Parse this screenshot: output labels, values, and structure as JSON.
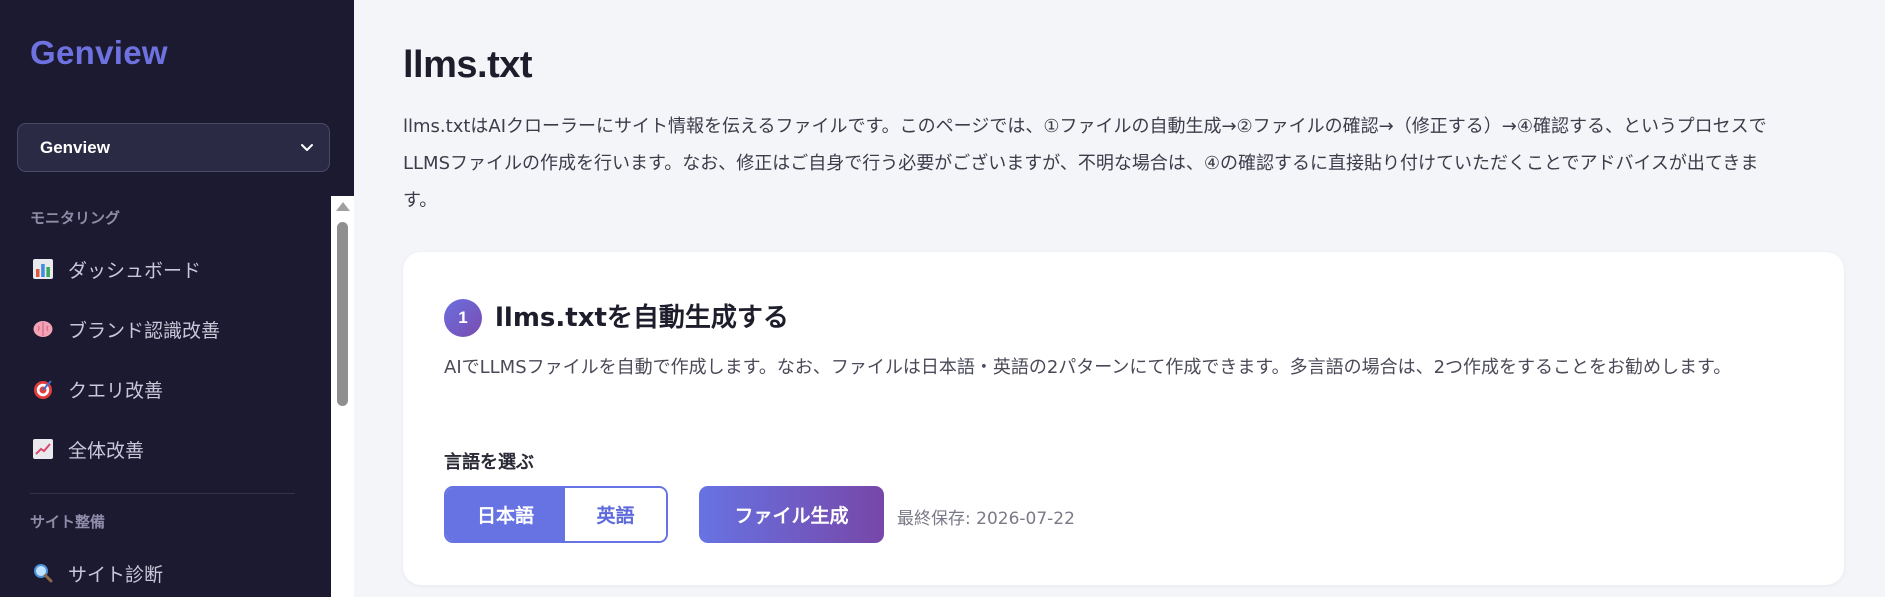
{
  "sidebar": {
    "logo": "Genview",
    "site_select": {
      "value": "Genview"
    },
    "sections": [
      {
        "title": "モニタリング",
        "items": [
          {
            "label": "ダッシュボード",
            "icon": "bar-chart-icon"
          },
          {
            "label": "ブランド認識改善",
            "icon": "brain-icon"
          },
          {
            "label": "クエリ改善",
            "icon": "target-icon"
          },
          {
            "label": "全体改善",
            "icon": "trend-chart-icon"
          }
        ]
      },
      {
        "title": "サイト整備",
        "items": [
          {
            "label": "サイト診断",
            "icon": "magnifier-icon"
          }
        ]
      }
    ]
  },
  "main": {
    "title": "llms.txt",
    "intro": "llms.txtはAIクローラーにサイト情報を伝えるファイルです。このページでは、①ファイルの自動生成→②ファイルの確認→（修正する）→④確認する、というプロセスでLLMSファイルの作成を行います。なお、修正はご自身で行う必要がございますが、不明な場合は、④の確認するに直接貼り付けていただくことでアドバイスが出てきます。",
    "step1": {
      "number": "1",
      "title": "llms.txtを自動生成する",
      "description": "AIでLLMSファイルを自動で作成します。なお、ファイルは日本語・英語の2パターンにて作成できます。多言語の場合は、2つ作成をすることをお勧めします。",
      "language_label": "言語を選ぶ",
      "languages": [
        {
          "label": "日本語",
          "selected": true
        },
        {
          "label": "英語",
          "selected": false
        }
      ],
      "generate_button": "ファイル生成",
      "last_saved": "最終保存: 2026-07-22"
    }
  },
  "colors": {
    "sidebar_bg": "#1c1a31",
    "accent": "#6773e3",
    "accent_gradient_end": "#7747a8",
    "page_bg": "#f4f5f9"
  }
}
